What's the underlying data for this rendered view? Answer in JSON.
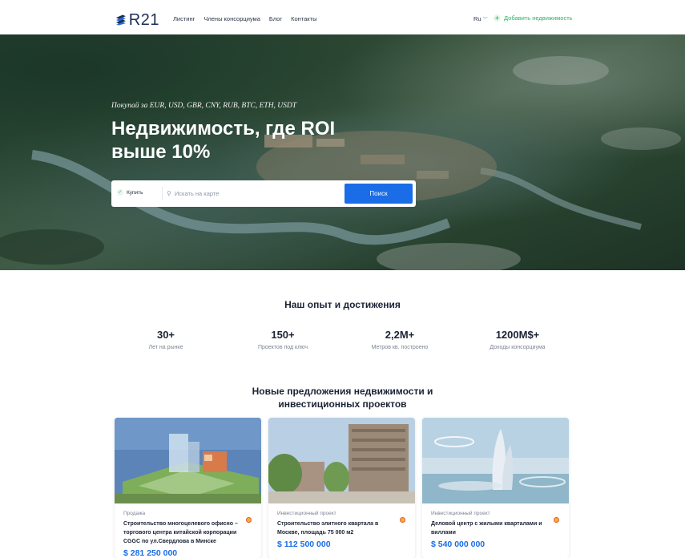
{
  "header": {
    "logo_text": "R21",
    "nav": [
      "Листинг",
      "Члены консорциума",
      "Блог",
      "Контакты"
    ],
    "lang": "Ru",
    "add_property": "Добавить недвижимость"
  },
  "hero": {
    "subtitle": "Покупай за EUR, USD, GBR, CNY, RUB, BTC, ETH, USDT",
    "title": "Недвижимость, где ROI выше 10%",
    "search": {
      "mode": "Купить",
      "map_placeholder": "Искать на карте",
      "button": "Поиск"
    }
  },
  "stats": {
    "title": "Наш опыт и достижения",
    "items": [
      {
        "value": "30+",
        "label": "Лет на рынке"
      },
      {
        "value": "150+",
        "label": "Проектов под ключ"
      },
      {
        "value": "2,2M+",
        "label": "Метров кв. построено"
      },
      {
        "value": "1200M$+",
        "label": "Доходы консорциума"
      }
    ]
  },
  "listings": {
    "title": "Новые предложения недвижимости и инвестиционных проектов",
    "cards": [
      {
        "type": "Продажа",
        "name": "Строительство многоцелевого офисно – торгового центра китайской корпорации CGGC по ул.Свердлова в Минске",
        "price": "$ 281 250 000"
      },
      {
        "type": "Инвестиционный проект",
        "name": "Строительство элитного квартала в Москве, площадь 75 000 м2",
        "price": "$ 112 500 000"
      },
      {
        "type": "Инвестиционный проект",
        "name": "Деловой центр с жилыми кварталами и виллами",
        "price": "$ 540 000 000"
      }
    ]
  },
  "colors": {
    "accent": "#1a6de6",
    "green": "#2eb163",
    "dark": "#1b2335"
  }
}
